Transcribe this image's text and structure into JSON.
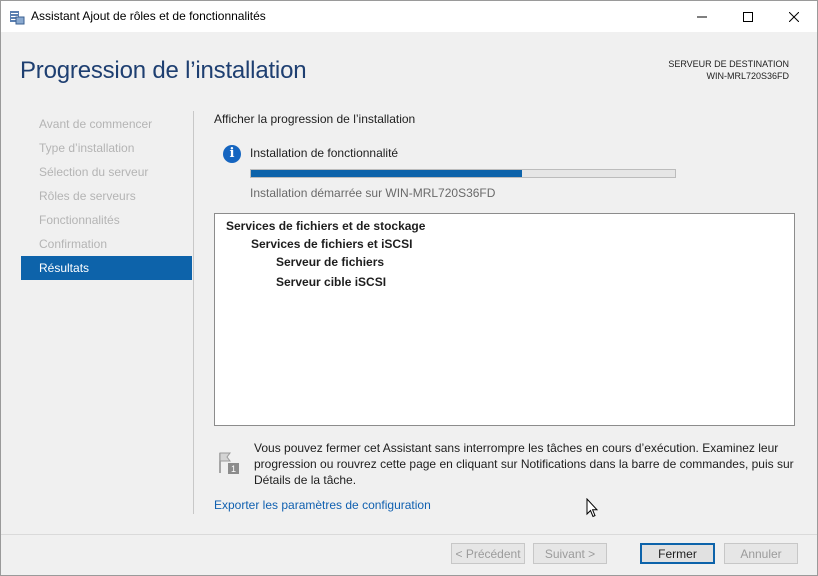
{
  "window": {
    "title": "Assistant Ajout de rôles et de fonctionnalités",
    "icon": "server-manager-icon"
  },
  "header": {
    "page_title": "Progression de l’installation",
    "destination_label": "SERVEUR DE DESTINATION",
    "destination_server": "WIN-MRL720S36FD"
  },
  "nav": {
    "items": [
      {
        "label": "Avant de commencer",
        "active": false
      },
      {
        "label": "Type d’installation",
        "active": false
      },
      {
        "label": "Sélection du serveur",
        "active": false
      },
      {
        "label": "Rôles de serveurs",
        "active": false
      },
      {
        "label": "Fonctionnalités",
        "active": false
      },
      {
        "label": "Confirmation",
        "active": false
      },
      {
        "label": "Résultats",
        "active": true
      }
    ]
  },
  "main": {
    "section_label": "Afficher la progression de l’installation",
    "status_label": "Installation de fonctionnalité",
    "progress_fraction": 0.64,
    "start_text": "Installation démarrée sur WIN-MRL720S36FD",
    "results": [
      {
        "label": "Services de fichiers et de stockage",
        "level": 0
      },
      {
        "label": "Services de fichiers et iSCSI",
        "level": 1
      },
      {
        "label": "Serveur de fichiers",
        "level": 2
      },
      {
        "label": "Serveur cible iSCSI",
        "level": 2
      }
    ],
    "note_text": "Vous pouvez fermer cet Assistant sans interrompre les tâches en cours d’exécution. Examinez leur progression ou rouvrez cette page en cliquant sur Notifications dans la barre de commandes, puis sur Détails de la tâche.",
    "export_link": "Exporter les paramètres de configuration"
  },
  "buttons": {
    "previous": "< Précédent",
    "next": "Suivant >",
    "close": "Fermer",
    "cancel": "Annuler"
  },
  "colors": {
    "accent": "#0d63aa",
    "title_blue": "#1e3f71",
    "link": "#1060b0"
  }
}
